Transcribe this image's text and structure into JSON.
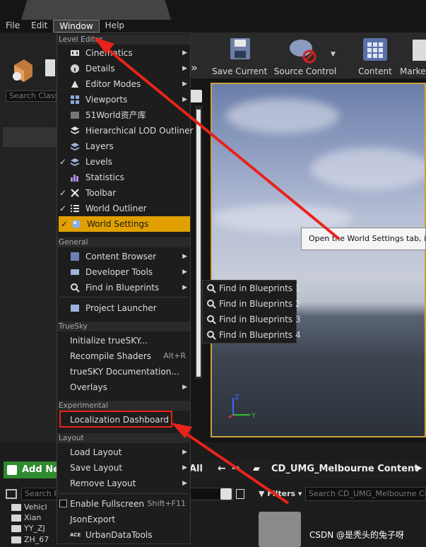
{
  "menubar": {
    "file": "File",
    "edit": "Edit",
    "window": "Window",
    "help": "Help"
  },
  "left_panel": {
    "search_placeholder": "Search Class"
  },
  "toolbar": {
    "save_current": "Save Current",
    "source_control": "Source Control",
    "content": "Content",
    "market": "Market"
  },
  "viewport": {
    "tooltip": "Open the World Settings tab, in wh"
  },
  "menu": {
    "section_level_editor": "Level Editor",
    "cinematics": "Cinematics",
    "details": "Details",
    "editor_modes": "Editor Modes",
    "viewports": "Viewports",
    "world_lib": "51World资产库",
    "hlod": "Hierarchical LOD Outliner",
    "layers": "Layers",
    "levels": "Levels",
    "statistics": "Statistics",
    "toolbar": "Toolbar",
    "world_outliner": "World Outliner",
    "world_settings": "World Settings",
    "section_general": "General",
    "content_browser": "Content Browser",
    "developer_tools": "Developer Tools",
    "find_in_blueprints": "Find in Blueprints",
    "project_launcher": "Project Launcher",
    "section_truesky": "TrueSky",
    "init_truesky": "Initialize trueSKY...",
    "recompile_shaders": "Recompile Shaders",
    "recompile_shortcut": "Alt+R",
    "truesky_doc": "trueSKY Documentation...",
    "overlays": "Overlays",
    "section_experimental": "Experimental",
    "localization_dashboard": "Localization Dashboard",
    "section_layout": "Layout",
    "load_layout": "Load Layout",
    "save_layout": "Save Layout",
    "remove_layout": "Remove Layout",
    "enable_fullscreen": "Enable Fullscreen",
    "fullscreen_shortcut": "Shift+F11",
    "json_export": "JsonExport",
    "urban_data_tools": "UrbanDataTools"
  },
  "submenu": {
    "fib1": "Find in Blueprints 1",
    "fib2": "Find in Blueprints 2",
    "fib3": "Find in Blueprints 3",
    "fib4": "Find in Blueprints 4"
  },
  "content_browser": {
    "add_new": "Add New",
    "all": "All",
    "path": "CD_UMG_Melbourne Content",
    "search_paths": "Search P",
    "filters": "Filters",
    "search_content": "Search CD_UMG_Melbourne Co",
    "tree": [
      "Vehicl",
      "Xian",
      "YY_ZJ",
      "ZH_67"
    ]
  },
  "watermark": "CSDN @是秃头的兔子呀",
  "colors": {
    "highlight": "#e0a000",
    "annotation": "#e8231a",
    "viewport_border": "#c9a23b"
  }
}
